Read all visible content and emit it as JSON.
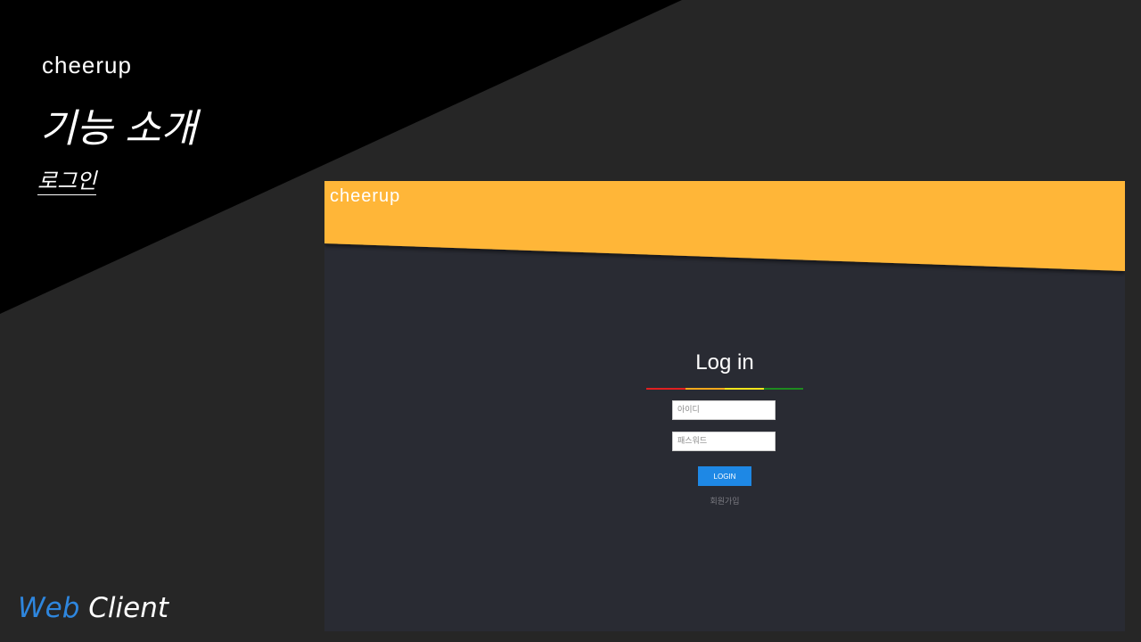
{
  "slide": {
    "brand": "cheerup",
    "section_title": "기능 소개",
    "sub_title": "로그인",
    "footer": {
      "accent_word": "Web",
      "rest_word": "Client"
    }
  },
  "app": {
    "brand": "cheerup",
    "header_color": "#ffb638",
    "body_color": "#292b33",
    "login": {
      "title": "Log in",
      "underline_colors": [
        "#e02020",
        "#f4a81c",
        "#f2e51b",
        "#1e8a1e"
      ],
      "id_placeholder": "아이디",
      "password_placeholder": "패스워드",
      "button_label": "LOGIN",
      "signup_label": "회원가입"
    }
  },
  "colors": {
    "slide_background": "#262626",
    "slide_triangle": "#000000",
    "accent_blue": "#2e86de",
    "button_blue": "#1e88e5"
  }
}
